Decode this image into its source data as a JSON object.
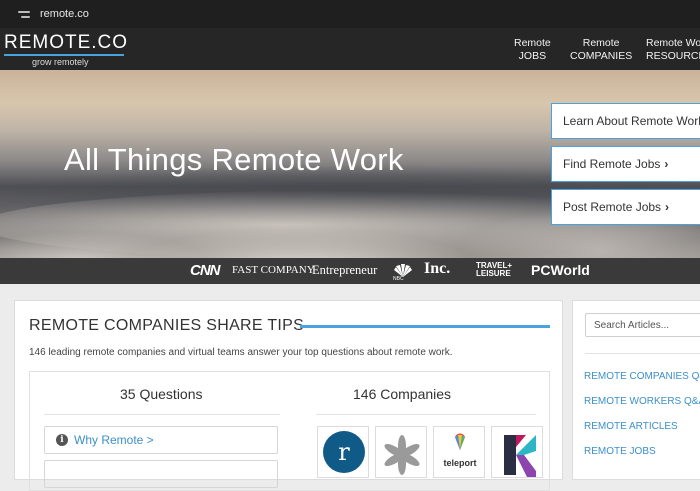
{
  "browser": {
    "url": "remote.co"
  },
  "logo": {
    "name": "REMOTE.CO",
    "tagline": "grow remotely"
  },
  "nav": [
    {
      "line1": "Remote",
      "line2": "JOBS"
    },
    {
      "line1": "Remote",
      "line2": "COMPANIES"
    },
    {
      "line1": "Remote Work",
      "line2": "RESOURCES"
    }
  ],
  "hero": {
    "title": "All Things Remote Work",
    "cta": [
      {
        "label": "Learn About Remote Work",
        "chevron": ""
      },
      {
        "label": "Find Remote Jobs",
        "chevron": "›"
      },
      {
        "label": "Post Remote Jobs",
        "chevron": "›"
      }
    ]
  },
  "press": [
    "CNN",
    "FAST COMPANY",
    "Entrepreneur",
    "NBC",
    "Inc.",
    "TRAVEL+",
    "LEISURE",
    "PCWorld"
  ],
  "tips": {
    "title": "REMOTE COMPANIES SHARE TIPS",
    "subtitle": "146 leading remote companies and virtual teams answer your top questions about remote work.",
    "questions_heading": "35 Questions",
    "companies_heading": "146 Companies",
    "why_remote": "Why Remote >",
    "company_tiles": [
      "r",
      "",
      "teleport",
      ""
    ]
  },
  "sidebar": {
    "search_placeholder": "Search Articles...",
    "links": [
      "REMOTE COMPANIES Q&A",
      "REMOTE WORKERS Q&A",
      "REMOTE ARTICLES",
      "REMOTE JOBS"
    ]
  },
  "colors": {
    "accent": "#4aa3df",
    "link": "#3b8fc9",
    "nav_bg": "#262626",
    "press_bg": "#3a3a3a"
  }
}
